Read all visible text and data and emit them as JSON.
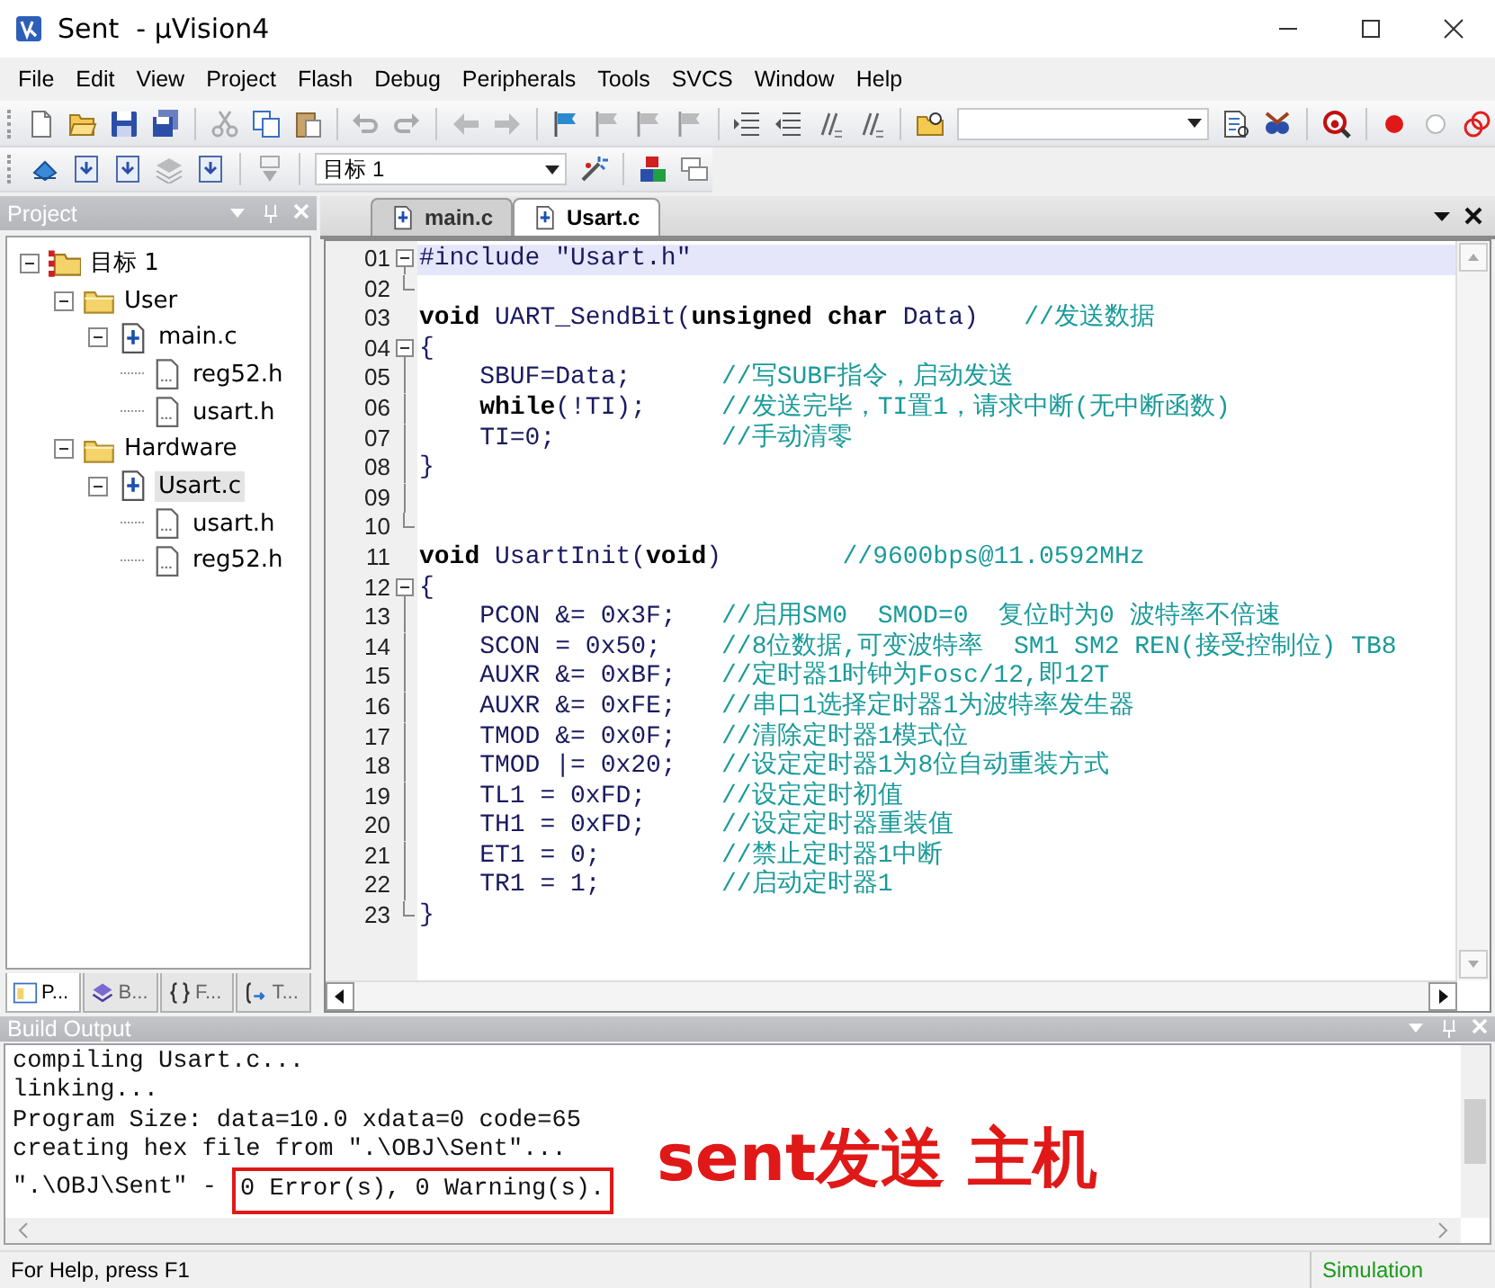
{
  "window": {
    "title": "Sent  - µVision4"
  },
  "menu": [
    "File",
    "Edit",
    "View",
    "Project",
    "Flash",
    "Debug",
    "Peripherals",
    "Tools",
    "SVCS",
    "Window",
    "Help"
  ],
  "toolbar": {
    "target": "目标 1"
  },
  "project": {
    "title": "Project",
    "tree": [
      {
        "label": "目标 1",
        "kind": "target",
        "selected": false,
        "expanded": true,
        "children": [
          {
            "label": "User",
            "kind": "folder",
            "selected": false,
            "expanded": true,
            "children": [
              {
                "label": "main.c",
                "kind": "source",
                "selected": false,
                "expanded": true,
                "children": [
                  {
                    "label": "reg52.h",
                    "kind": "header",
                    "selected": false
                  },
                  {
                    "label": "usart.h",
                    "kind": "header",
                    "selected": false
                  }
                ]
              }
            ]
          },
          {
            "label": "Hardware",
            "kind": "folder",
            "selected": false,
            "expanded": true,
            "children": [
              {
                "label": "Usart.c",
                "kind": "source",
                "selected": true,
                "expanded": true,
                "children": [
                  {
                    "label": "usart.h",
                    "kind": "header",
                    "selected": false
                  },
                  {
                    "label": "reg52.h",
                    "kind": "header",
                    "selected": false
                  }
                ]
              }
            ]
          }
        ]
      }
    ],
    "tabs": [
      {
        "label": "P...",
        "kind": "project",
        "selected": true
      },
      {
        "label": "B...",
        "kind": "books",
        "selected": false
      },
      {
        "label": "F...",
        "kind": "functions",
        "selected": false
      },
      {
        "label": "T...",
        "kind": "templates",
        "selected": false
      }
    ]
  },
  "editor": {
    "tabs": [
      {
        "label": "main.c",
        "selected": false
      },
      {
        "label": "Usart.c",
        "selected": true
      }
    ],
    "lines": [
      {
        "number": "01",
        "code": "#include \"Usart.h\"",
        "fold_start": true,
        "fold_end": false,
        "current": true
      },
      {
        "number": "02",
        "fold_start": false,
        "fold_end": true,
        "current": false
      },
      {
        "number": "03",
        "code": "**void** UART_SendBit(**unsigned** **char** Data)   ",
        "comment": "//发送数据",
        "fold_start": false,
        "fold_end": false,
        "current": false
      },
      {
        "number": "04",
        "code": "{",
        "fold_start": true,
        "fold_end": false,
        "current": false
      },
      {
        "number": "05",
        "code": "    SBUF=Data;      ",
        "comment": "//写SUBF指令，启动发送",
        "fold_start": false,
        "fold_end": false,
        "current": false
      },
      {
        "number": "06",
        "code": "    **while**(!TI);     ",
        "comment": "//发送完毕，TI置1，请求中断(无中断函数)",
        "fold_start": false,
        "fold_end": false,
        "current": false
      },
      {
        "number": "07",
        "code": "    TI=0;           ",
        "comment": "//手动清零",
        "fold_start": false,
        "fold_end": false,
        "current": false
      },
      {
        "number": "08",
        "code": "}",
        "fold_start": false,
        "fold_end": false,
        "current": false
      },
      {
        "number": "09",
        "fold_start": false,
        "fold_end": false,
        "current": false
      },
      {
        "number": "10",
        "fold_start": false,
        "fold_end": true,
        "current": false
      },
      {
        "number": "11",
        "code": "**void** UsartInit(**void**)        ",
        "comment": "//9600bps@11.0592MHz",
        "fold_start": false,
        "fold_end": false,
        "current": false
      },
      {
        "number": "12",
        "code": "{",
        "fold_start": true,
        "fold_end": false,
        "current": false
      },
      {
        "number": "13",
        "code": "    PCON &= 0x3F;   ",
        "comment": "//启用SM0  SMOD=0  复位时为0 波特率不倍速",
        "fold_start": false,
        "fold_end": false,
        "current": false
      },
      {
        "number": "14",
        "code": "    SCON = 0x50;    ",
        "comment": "//8位数据,可变波特率  SM1 SM2 REN(接受控制位) TB8",
        "fold_start": false,
        "fold_end": false,
        "current": false
      },
      {
        "number": "15",
        "code": "    AUXR &= 0xBF;   ",
        "comment": "//定时器1时钟为Fosc/12,即12T",
        "fold_start": false,
        "fold_end": false,
        "current": false
      },
      {
        "number": "16",
        "code": "    AUXR &= 0xFE;   ",
        "comment": "//串口1选择定时器1为波特率发生器",
        "fold_start": false,
        "fold_end": false,
        "current": false
      },
      {
        "number": "17",
        "code": "    TMOD &= 0x0F;   ",
        "comment": "//清除定时器1模式位",
        "fold_start": false,
        "fold_end": false,
        "current": false
      },
      {
        "number": "18",
        "code": "    TMOD |= 0x20;   ",
        "comment": "//设定定时器1为8位自动重装方式",
        "fold_start": false,
        "fold_end": false,
        "current": false
      },
      {
        "number": "19",
        "code": "    TL1 = 0xFD;     ",
        "comment": "//设定定时初值",
        "fold_start": false,
        "fold_end": false,
        "current": false
      },
      {
        "number": "20",
        "code": "    TH1 = 0xFD;     ",
        "comment": "//设定定时器重装值",
        "fold_start": false,
        "fold_end": false,
        "current": false
      },
      {
        "number": "21",
        "code": "    ET1 = 0;        ",
        "comment": "//禁止定时器1中断",
        "fold_start": false,
        "fold_end": false,
        "current": false
      },
      {
        "number": "22",
        "code": "    TR1 = 1;        ",
        "comment": "//启动定时器1",
        "fold_start": false,
        "fold_end": false,
        "current": false
      },
      {
        "number": "23",
        "code": "}",
        "fold_start": false,
        "fold_end": true,
        "current": false
      }
    ]
  },
  "build_output": {
    "title": "Build Output",
    "lines": [
      [
        {
          "text": "compiling Usart.c...",
          "boxed": false
        }
      ],
      [
        {
          "text": "linking...",
          "boxed": false
        }
      ],
      [
        {
          "text": "Program Size: data=10.0 xdata=0 code=65",
          "boxed": false
        }
      ],
      [
        {
          "text": "creating hex file from \".\\OBJ\\Sent\"...",
          "boxed": false
        }
      ],
      [
        {
          "text": "\".\\OBJ\\Sent\" - ",
          "boxed": false
        },
        {
          "text": "0 Error(s), 0 Warning(s).",
          "boxed": true
        }
      ]
    ]
  },
  "annotation": {
    "text": "sent发送 主机"
  },
  "status_bar": {
    "help": "For Help, press F1",
    "mode": "Simulation"
  }
}
